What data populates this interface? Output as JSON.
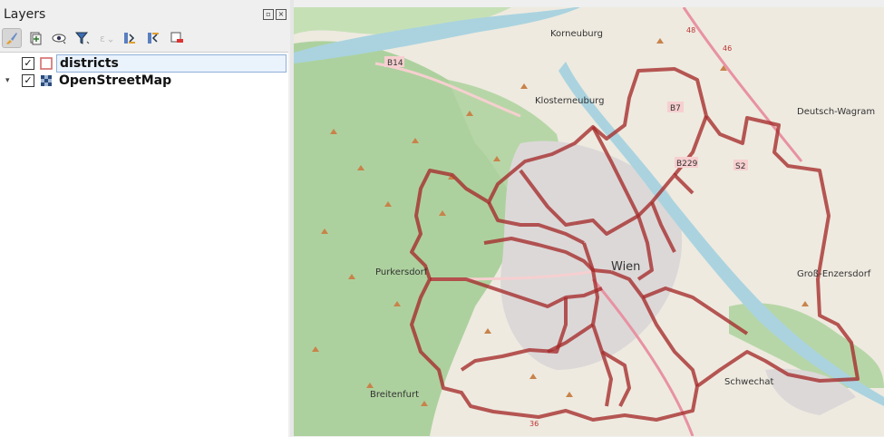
{
  "panel": {
    "title": "Layers"
  },
  "layers": [
    {
      "name": "districts",
      "checked": "✓",
      "expander": ""
    },
    {
      "name": "OpenStreetMap",
      "checked": "✓",
      "expander": "▾"
    }
  ],
  "map": {
    "labels": {
      "korneuburg": "Korneuburg",
      "b14": "B14",
      "klosterneuburg": "Klosterneuburg",
      "b7": "B7",
      "deutsch_wagram": "Deutsch-Wagram",
      "b229": "B229",
      "s2": "S2",
      "wien": "Wien",
      "purkersdorf": "Purkersdorf",
      "gross_enzersdorf": "Groß-Enzersdorf",
      "schwechat": "Schwechat",
      "breitenfurt": "Breitenfurt",
      "road_48": "48",
      "road_46": "46",
      "road_36": "36"
    }
  },
  "colors": {
    "district_border": "#a52a2a",
    "water": "#aad3df",
    "forest": "#add19e",
    "land": "#eeeae0"
  }
}
